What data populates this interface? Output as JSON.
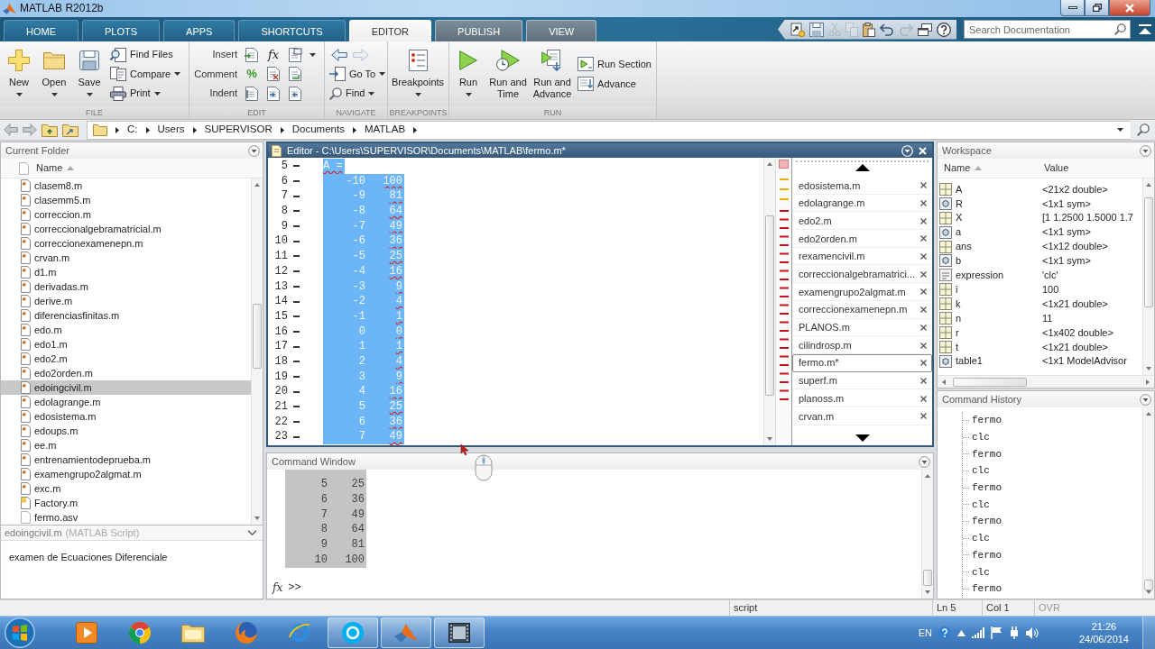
{
  "window": {
    "title": "MATLAB R2012b"
  },
  "ribbon_tabs": [
    {
      "label": "HOME",
      "selected": false,
      "contextual": false
    },
    {
      "label": "PLOTS",
      "selected": false,
      "contextual": false
    },
    {
      "label": "APPS",
      "selected": false,
      "contextual": false
    },
    {
      "label": "SHORTCUTS",
      "selected": false,
      "contextual": false
    },
    {
      "label": "EDITOR",
      "selected": true,
      "contextual": true
    },
    {
      "label": "PUBLISH",
      "selected": false,
      "contextual": true
    },
    {
      "label": "VIEW",
      "selected": false,
      "contextual": true
    }
  ],
  "quick_access": [
    {
      "disabled": false
    },
    {
      "disabled": false
    },
    {
      "disabled": true
    },
    {
      "disabled": true
    },
    {
      "disabled": false
    },
    {
      "disabled": false
    },
    {
      "disabled": true
    },
    {
      "disabled": false
    },
    {
      "disabled": false
    }
  ],
  "search": {
    "placeholder": "Search Documentation"
  },
  "ribbon_groups": [
    {
      "label": "FILE",
      "columns": [
        {
          "kind": "large",
          "label": "New",
          "dropdown": true
        },
        {
          "kind": "large",
          "label": "Open",
          "dropdown": true
        },
        {
          "kind": "large",
          "label": "Save",
          "dropdown": true
        },
        {
          "kind": "stack",
          "items": [
            {
              "kind": "button",
              "label": "Find Files",
              "dropdown": false
            },
            {
              "kind": "button",
              "label": "Compare",
              "dropdown": true
            },
            {
              "kind": "button",
              "label": "Print",
              "dropdown": true
            }
          ]
        }
      ]
    },
    {
      "label": "EDIT",
      "columns": [
        {
          "kind": "rows",
          "items": [
            {
              "label": "Insert",
              "symbol": "fx",
              "dropdown": true
            },
            {
              "label": "Comment",
              "symbol": "%",
              "dropdown": false
            },
            {
              "label": "Indent",
              "dropdown": false
            }
          ]
        }
      ]
    },
    {
      "label": "NAVIGATE",
      "columns": [
        {
          "kind": "stack",
          "items": [
            {
              "kind": "arrows",
              "arrows": [
                {
                  "disabled": false
                },
                {
                  "disabled": true
                }
              ]
            },
            {
              "kind": "button",
              "label": "Go To",
              "dropdown": true
            },
            {
              "kind": "button",
              "label": "Find",
              "dropdown": true
            }
          ]
        }
      ]
    },
    {
      "label": "BREAKPOINTS",
      "columns": [
        {
          "kind": "large",
          "label": "Breakpoints",
          "dropdown": true
        }
      ]
    },
    {
      "label": "RUN",
      "columns": [
        {
          "kind": "large",
          "label": "Run",
          "dropdown": true
        },
        {
          "kind": "large",
          "label": "Run and Time",
          "dropdown": false
        },
        {
          "kind": "large",
          "label": "Run and Advance",
          "dropdown": false
        },
        {
          "kind": "stack",
          "items": [
            {
              "kind": "button",
              "label": "Run Section",
              "dropdown": false
            },
            {
              "kind": "button",
              "label": "Advance",
              "dropdown": false
            }
          ]
        }
      ]
    }
  ],
  "address_bar": {
    "path": [
      "C:",
      "Users",
      "SUPERVISOR",
      "Documents",
      "MATLAB"
    ]
  },
  "current_folder": {
    "title": "Current Folder",
    "columns": [
      {
        "label": "Name",
        "sorted": true
      }
    ],
    "files": [
      {
        "name": "clasem8.m",
        "kind": "script",
        "selected": false
      },
      {
        "name": "clasemm5.m",
        "kind": "script",
        "selected": false
      },
      {
        "name": "correccion.m",
        "kind": "script",
        "selected": false
      },
      {
        "name": "correccionalgebramatricial.m",
        "kind": "script",
        "selected": false
      },
      {
        "name": "correccionexamenepn.m",
        "kind": "script",
        "selected": false
      },
      {
        "name": "crvan.m",
        "kind": "script",
        "selected": false
      },
      {
        "name": "d1.m",
        "kind": "script",
        "selected": false
      },
      {
        "name": "derivadas.m",
        "kind": "script",
        "selected": false
      },
      {
        "name": "derive.m",
        "kind": "script",
        "selected": false
      },
      {
        "name": "diferenciasfinitas.m",
        "kind": "script",
        "selected": false
      },
      {
        "name": "edo.m",
        "kind": "script",
        "selected": false
      },
      {
        "name": "edo1.m",
        "kind": "script",
        "selected": false
      },
      {
        "name": "edo2.m",
        "kind": "script",
        "selected": false
      },
      {
        "name": "edo2orden.m",
        "kind": "script",
        "selected": false
      },
      {
        "name": "edoingcivil.m",
        "kind": "script",
        "selected": true
      },
      {
        "name": "edolagrange.m",
        "kind": "script",
        "selected": false
      },
      {
        "name": "edosistema.m",
        "kind": "script",
        "selected": false
      },
      {
        "name": "edoups.m",
        "kind": "script",
        "selected": false
      },
      {
        "name": "ee.m",
        "kind": "script",
        "selected": false
      },
      {
        "name": "entrenamientodeprueba.m",
        "kind": "script",
        "selected": false
      },
      {
        "name": "examengrupo2algmat.m",
        "kind": "script",
        "selected": false
      },
      {
        "name": "exc.m",
        "kind": "script",
        "selected": false
      },
      {
        "name": "Factory.m",
        "kind": "function",
        "selected": false
      },
      {
        "name": "fermo.asv",
        "kind": "file",
        "selected": false
      }
    ],
    "details": {
      "name": "edoingcivil.m",
      "type": "(MATLAB Script)",
      "description": "examen de Ecuaciones Diferenciale"
    }
  },
  "editor": {
    "title": "Editor - C:\\Users\\SUPERVISOR\\Documents\\MATLAB\\fermo.m*",
    "lines": [
      {
        "number": "5",
        "kind": "text",
        "code": "A =",
        "selected": true,
        "flagged": true
      },
      {
        "number": "6",
        "kind": "values",
        "cells": [
          "-10",
          "100"
        ],
        "selected": true,
        "flagged": true
      },
      {
        "number": "7",
        "kind": "values",
        "cells": [
          "-9",
          "81"
        ],
        "selected": true,
        "flagged": true
      },
      {
        "number": "8",
        "kind": "values",
        "cells": [
          "-8",
          "64"
        ],
        "selected": true,
        "flagged": true
      },
      {
        "number": "9",
        "kind": "values",
        "cells": [
          "-7",
          "49"
        ],
        "selected": true,
        "flagged": true
      },
      {
        "number": "10",
        "kind": "values",
        "cells": [
          "-6",
          "36"
        ],
        "selected": true,
        "flagged": true
      },
      {
        "number": "11",
        "kind": "values",
        "cells": [
          "-5",
          "25"
        ],
        "selected": true,
        "flagged": true
      },
      {
        "number": "12",
        "kind": "values",
        "cells": [
          "-4",
          "16"
        ],
        "selected": true,
        "flagged": true
      },
      {
        "number": "13",
        "kind": "values",
        "cells": [
          "-3",
          "9"
        ],
        "selected": true,
        "flagged": true
      },
      {
        "number": "14",
        "kind": "values",
        "cells": [
          "-2",
          "4"
        ],
        "selected": true,
        "flagged": true
      },
      {
        "number": "15",
        "kind": "values",
        "cells": [
          "-1",
          "1"
        ],
        "selected": true,
        "flagged": true
      },
      {
        "number": "16",
        "kind": "values",
        "cells": [
          "0",
          "0"
        ],
        "selected": true,
        "flagged": true
      },
      {
        "number": "17",
        "kind": "values",
        "cells": [
          "1",
          "1"
        ],
        "selected": true,
        "flagged": true
      },
      {
        "number": "18",
        "kind": "values",
        "cells": [
          "2",
          "4"
        ],
        "selected": true,
        "flagged": true
      },
      {
        "number": "19",
        "kind": "values",
        "cells": [
          "3",
          "9"
        ],
        "selected": true,
        "flagged": true
      },
      {
        "number": "20",
        "kind": "values",
        "cells": [
          "4",
          "16"
        ],
        "selected": true,
        "flagged": true
      },
      {
        "number": "21",
        "kind": "values",
        "cells": [
          "5",
          "25"
        ],
        "selected": true,
        "flagged": true
      },
      {
        "number": "22",
        "kind": "values",
        "cells": [
          "6",
          "36"
        ],
        "selected": true,
        "flagged": true
      },
      {
        "number": "23",
        "kind": "values",
        "cells": [
          "7",
          "49"
        ],
        "selected": true,
        "flagged": true
      }
    ],
    "documents": [
      {
        "name": "edosistema.m",
        "selected": false
      },
      {
        "name": "edolagrange.m",
        "selected": false
      },
      {
        "name": "edo2.m",
        "selected": false
      },
      {
        "name": "edo2orden.m",
        "selected": false
      },
      {
        "name": "rexamencivil.m",
        "selected": false
      },
      {
        "name": "correccionalgebramatrici...",
        "selected": false
      },
      {
        "name": "examengrupo2algmat.m",
        "selected": false
      },
      {
        "name": "correccionexamenepn.m",
        "selected": false
      },
      {
        "name": "PLANOS.m",
        "selected": false
      },
      {
        "name": "cilindrosp.m",
        "selected": false
      },
      {
        "name": "fermo.m*",
        "selected": true
      },
      {
        "name": "superf.m",
        "selected": false
      },
      {
        "name": "planoss.m",
        "selected": false
      },
      {
        "name": "crvan.m",
        "selected": false
      }
    ]
  },
  "command_window": {
    "title": "Command Window",
    "output": {
      "selected": true,
      "rows": [
        [
          "5",
          "25"
        ],
        [
          "6",
          "36"
        ],
        [
          "7",
          "49"
        ],
        [
          "8",
          "64"
        ],
        [
          "9",
          "81"
        ],
        [
          "10",
          "100"
        ]
      ]
    },
    "function_browser": "fx",
    "prompt": ">>"
  },
  "workspace": {
    "title": "Workspace",
    "columns": [
      {
        "label": "Name",
        "sorted": true
      },
      {
        "label": "Value",
        "sorted": false
      }
    ],
    "variables": [
      {
        "name": "A",
        "value": "<21x2 double>",
        "kind": "matrix"
      },
      {
        "name": "R",
        "value": "<1x1 sym>",
        "kind": "sym"
      },
      {
        "name": "X",
        "value": "[1 1.2500 1.5000 1.7",
        "kind": "matrix"
      },
      {
        "name": "a",
        "value": "<1x1 sym>",
        "kind": "sym"
      },
      {
        "name": "ans",
        "value": "<1x12 double>",
        "kind": "matrix"
      },
      {
        "name": "b",
        "value": "<1x1 sym>",
        "kind": "sym"
      },
      {
        "name": "expression",
        "value": "'clc'",
        "kind": "char"
      },
      {
        "name": "i",
        "value": "100",
        "kind": "matrix"
      },
      {
        "name": "k",
        "value": "<1x21 double>",
        "kind": "matrix"
      },
      {
        "name": "n",
        "value": "11",
        "kind": "matrix"
      },
      {
        "name": "r",
        "value": "<1x402 double>",
        "kind": "matrix"
      },
      {
        "name": "t",
        "value": "<1x21 double>",
        "kind": "matrix"
      },
      {
        "name": "table1",
        "value": "<1x1 ModelAdvisor",
        "kind": "object"
      }
    ]
  },
  "command_history": {
    "title": "Command History",
    "entries": [
      "fermo",
      "clc",
      "fermo",
      "clc",
      "fermo",
      "clc",
      "fermo",
      "clc",
      "fermo",
      "clc",
      "fermo"
    ]
  },
  "status": {
    "mode": "script",
    "line": "Ln 5",
    "column": "Col 1",
    "overwrite": {
      "label": "OVR",
      "on": false
    }
  },
  "taskbar": {
    "apps": [
      {
        "active": false
      },
      {
        "active": false
      },
      {
        "active": false
      },
      {
        "active": false
      },
      {
        "active": false
      },
      {
        "active": true
      },
      {
        "active": true
      },
      {
        "active": true
      }
    ],
    "language": "EN",
    "time": "21:26",
    "date": "24/06/2014"
  }
}
